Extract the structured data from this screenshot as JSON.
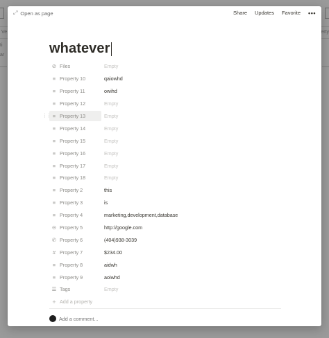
{
  "background": {
    "left_label": "Ve",
    "left_label2": "ti",
    "left_label3": "ar",
    "right_label": "perty"
  },
  "topbar": {
    "open_as_page": "Open as page",
    "share": "Share",
    "updates": "Updates",
    "favorite": "Favorite",
    "more": "•••"
  },
  "page": {
    "title": "whatever"
  },
  "properties": [
    {
      "icon": "paperclip-icon",
      "glyph": "⊘",
      "name": "Files",
      "value": "Empty",
      "empty": true
    },
    {
      "icon": "text-icon",
      "glyph": "≡",
      "name": "Property 10",
      "value": "qaiowhd",
      "empty": false
    },
    {
      "icon": "text-icon",
      "glyph": "≡",
      "name": "Property 11",
      "value": "owihd",
      "empty": false
    },
    {
      "icon": "text-icon",
      "glyph": "≡",
      "name": "Property 12",
      "value": "Empty",
      "empty": true
    },
    {
      "icon": "text-icon",
      "glyph": "≡",
      "name": "Property 13",
      "value": "Empty",
      "empty": true
    },
    {
      "icon": "text-icon",
      "glyph": "≡",
      "name": "Property 14",
      "value": "Empty",
      "empty": true
    },
    {
      "icon": "text-icon",
      "glyph": "≡",
      "name": "Property 15",
      "value": "Empty",
      "empty": true
    },
    {
      "icon": "text-icon",
      "glyph": "≡",
      "name": "Property 16",
      "value": "Empty",
      "empty": true
    },
    {
      "icon": "text-icon",
      "glyph": "≡",
      "name": "Property 17",
      "value": "Empty",
      "empty": true
    },
    {
      "icon": "text-icon",
      "glyph": "≡",
      "name": "Property 18",
      "value": "Empty",
      "empty": true
    },
    {
      "icon": "text-icon",
      "glyph": "≡",
      "name": "Property 2",
      "value": "this",
      "empty": false
    },
    {
      "icon": "text-icon",
      "glyph": "≡",
      "name": "Property 3",
      "value": "is",
      "empty": false
    },
    {
      "icon": "text-icon",
      "glyph": "≡",
      "name": "Property 4",
      "value": "marketing,development,database",
      "empty": false
    },
    {
      "icon": "link-icon",
      "glyph": "⊝",
      "name": "Property 5",
      "value": "http://google.com",
      "empty": false
    },
    {
      "icon": "phone-icon",
      "glyph": "✆",
      "name": "Property 6",
      "value": "(404)938-3039",
      "empty": false
    },
    {
      "icon": "number-icon",
      "glyph": "#",
      "name": "Property 7",
      "value": "$234.00",
      "empty": false
    },
    {
      "icon": "text-icon",
      "glyph": "≡",
      "name": "Property 8",
      "value": "aidwh",
      "empty": false
    },
    {
      "icon": "text-icon",
      "glyph": "≡",
      "name": "Property 9",
      "value": "aoiwhd",
      "empty": false
    },
    {
      "icon": "list-icon",
      "glyph": "☰",
      "name": "Tags",
      "value": "Empty",
      "empty": true
    }
  ],
  "add_property": {
    "glyph": "+",
    "label": "Add a property"
  },
  "comment": {
    "placeholder": "Add a comment..."
  },
  "hover_row_index": 4,
  "drag_handle": "⋮⋮"
}
